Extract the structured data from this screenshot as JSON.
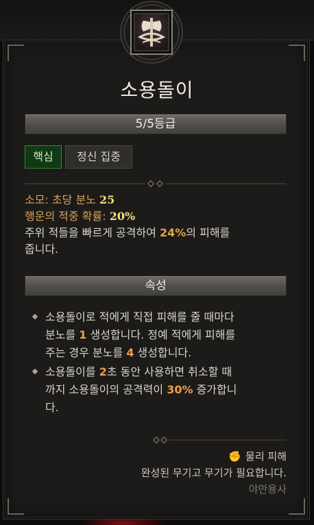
{
  "skill": {
    "name": "소용돌이",
    "rank": "5/5등급",
    "tags": [
      "핵심",
      "정신 집중"
    ]
  },
  "stats": {
    "cost_label": "소모:",
    "cost_text": "초당 분노",
    "cost_value": "25",
    "crit_label": "행운의 적중 확률:",
    "crit_value": "20%",
    "desc_part1": "주위 적들을 빠르게 공격하여",
    "desc_value": "24%",
    "desc_part2": "의 피해를",
    "desc_part3": "줍니다."
  },
  "attributes": {
    "header": "속성",
    "b1_a": "소용돌이로 적에게 직접 피해를 줄 때마다",
    "b1_b": "분노를",
    "b1_v1": "1",
    "b1_c": "생성합니다. 정예 적에게 피해를",
    "b1_d": "주는 경우 분노를",
    "b1_v2": "4",
    "b1_e": "생성합니다.",
    "b2_a": "소용돌이를",
    "b2_v1": "2",
    "b2_b": "초 동안 사용하면 취소할 때",
    "b2_c": "까지 소용돌이의 공격력이",
    "b2_v2": "30%",
    "b2_d": "증가합니",
    "b2_e": "다."
  },
  "footer": {
    "damage_type": "물리 피해",
    "requirement": "완성된 무기고 무기가 필요합니다.",
    "class_name": "야만용사"
  },
  "icons": {
    "emblem": "whirlwind-skill-icon",
    "damage": "fist-icon"
  },
  "colors": {
    "accent_orange": "#e6a24a",
    "accent_yellow": "#f4e07a",
    "core_tag_green": "#2f8a2f"
  }
}
